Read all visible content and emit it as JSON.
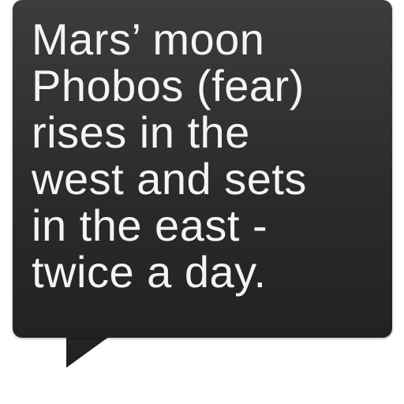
{
  "fact": {
    "text": "Mars’ moon\nPhobos (fear)\nrises in the\nwest and sets\nin the east -\ntwice a day."
  },
  "colors": {
    "bubble_top": "#3c3c3c",
    "bubble_bottom": "#222222",
    "text": "#f4f4f4",
    "background": "#ffffff"
  }
}
